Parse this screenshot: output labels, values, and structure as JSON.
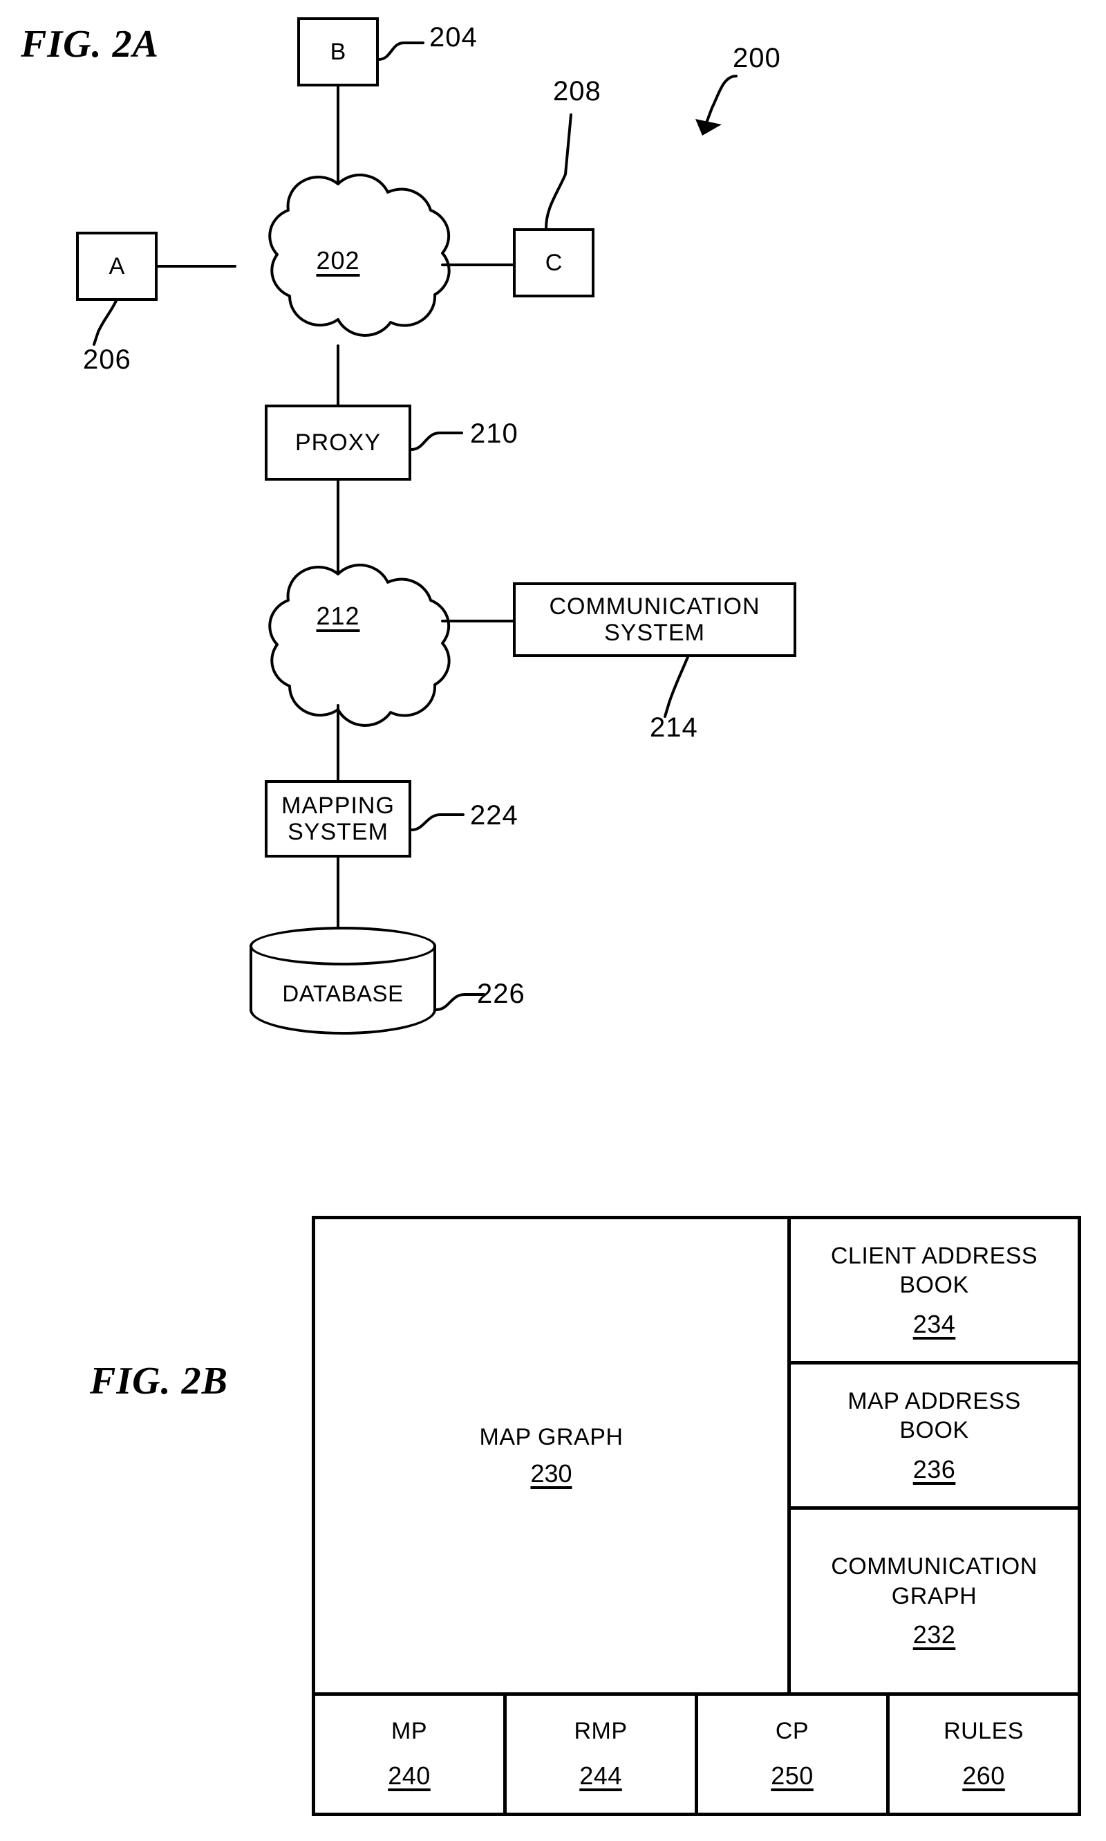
{
  "figures": {
    "fig2a": {
      "title": "FIG. 2A",
      "system_ref": "200",
      "nodes": {
        "client_b": {
          "label": "B",
          "ref": "204"
        },
        "client_a": {
          "label": "A",
          "ref": "206"
        },
        "client_c": {
          "label": "C",
          "ref": "208"
        },
        "network_top": {
          "label": "202",
          "shape": "cloud"
        },
        "proxy": {
          "label": "PROXY",
          "ref": "210"
        },
        "network_bottom": {
          "label": "212",
          "shape": "cloud"
        },
        "communication_system": {
          "label": "COMMUNICATION\nSYSTEM",
          "ref": "214"
        },
        "mapping_system": {
          "label": "MAPPING\nSYSTEM",
          "ref": "224"
        },
        "database": {
          "label": "DATABASE",
          "ref": "226",
          "shape": "cylinder"
        }
      }
    },
    "fig2b": {
      "title": "FIG. 2B",
      "map_graph": {
        "label": "MAP GRAPH",
        "ref": "230"
      },
      "right_column": [
        {
          "label": "CLIENT ADDRESS\nBOOK",
          "ref": "234"
        },
        {
          "label": "MAP ADDRESS\nBOOK",
          "ref": "236"
        },
        {
          "label": "COMMUNICATION\nGRAPH",
          "ref": "232"
        }
      ],
      "bottom_row": [
        {
          "label": "MP",
          "ref": "240"
        },
        {
          "label": "RMP",
          "ref": "244"
        },
        {
          "label": "CP",
          "ref": "250"
        },
        {
          "label": "RULES",
          "ref": "260"
        }
      ]
    }
  },
  "colors": {
    "ink": "#000000",
    "paper": "#ffffff"
  }
}
